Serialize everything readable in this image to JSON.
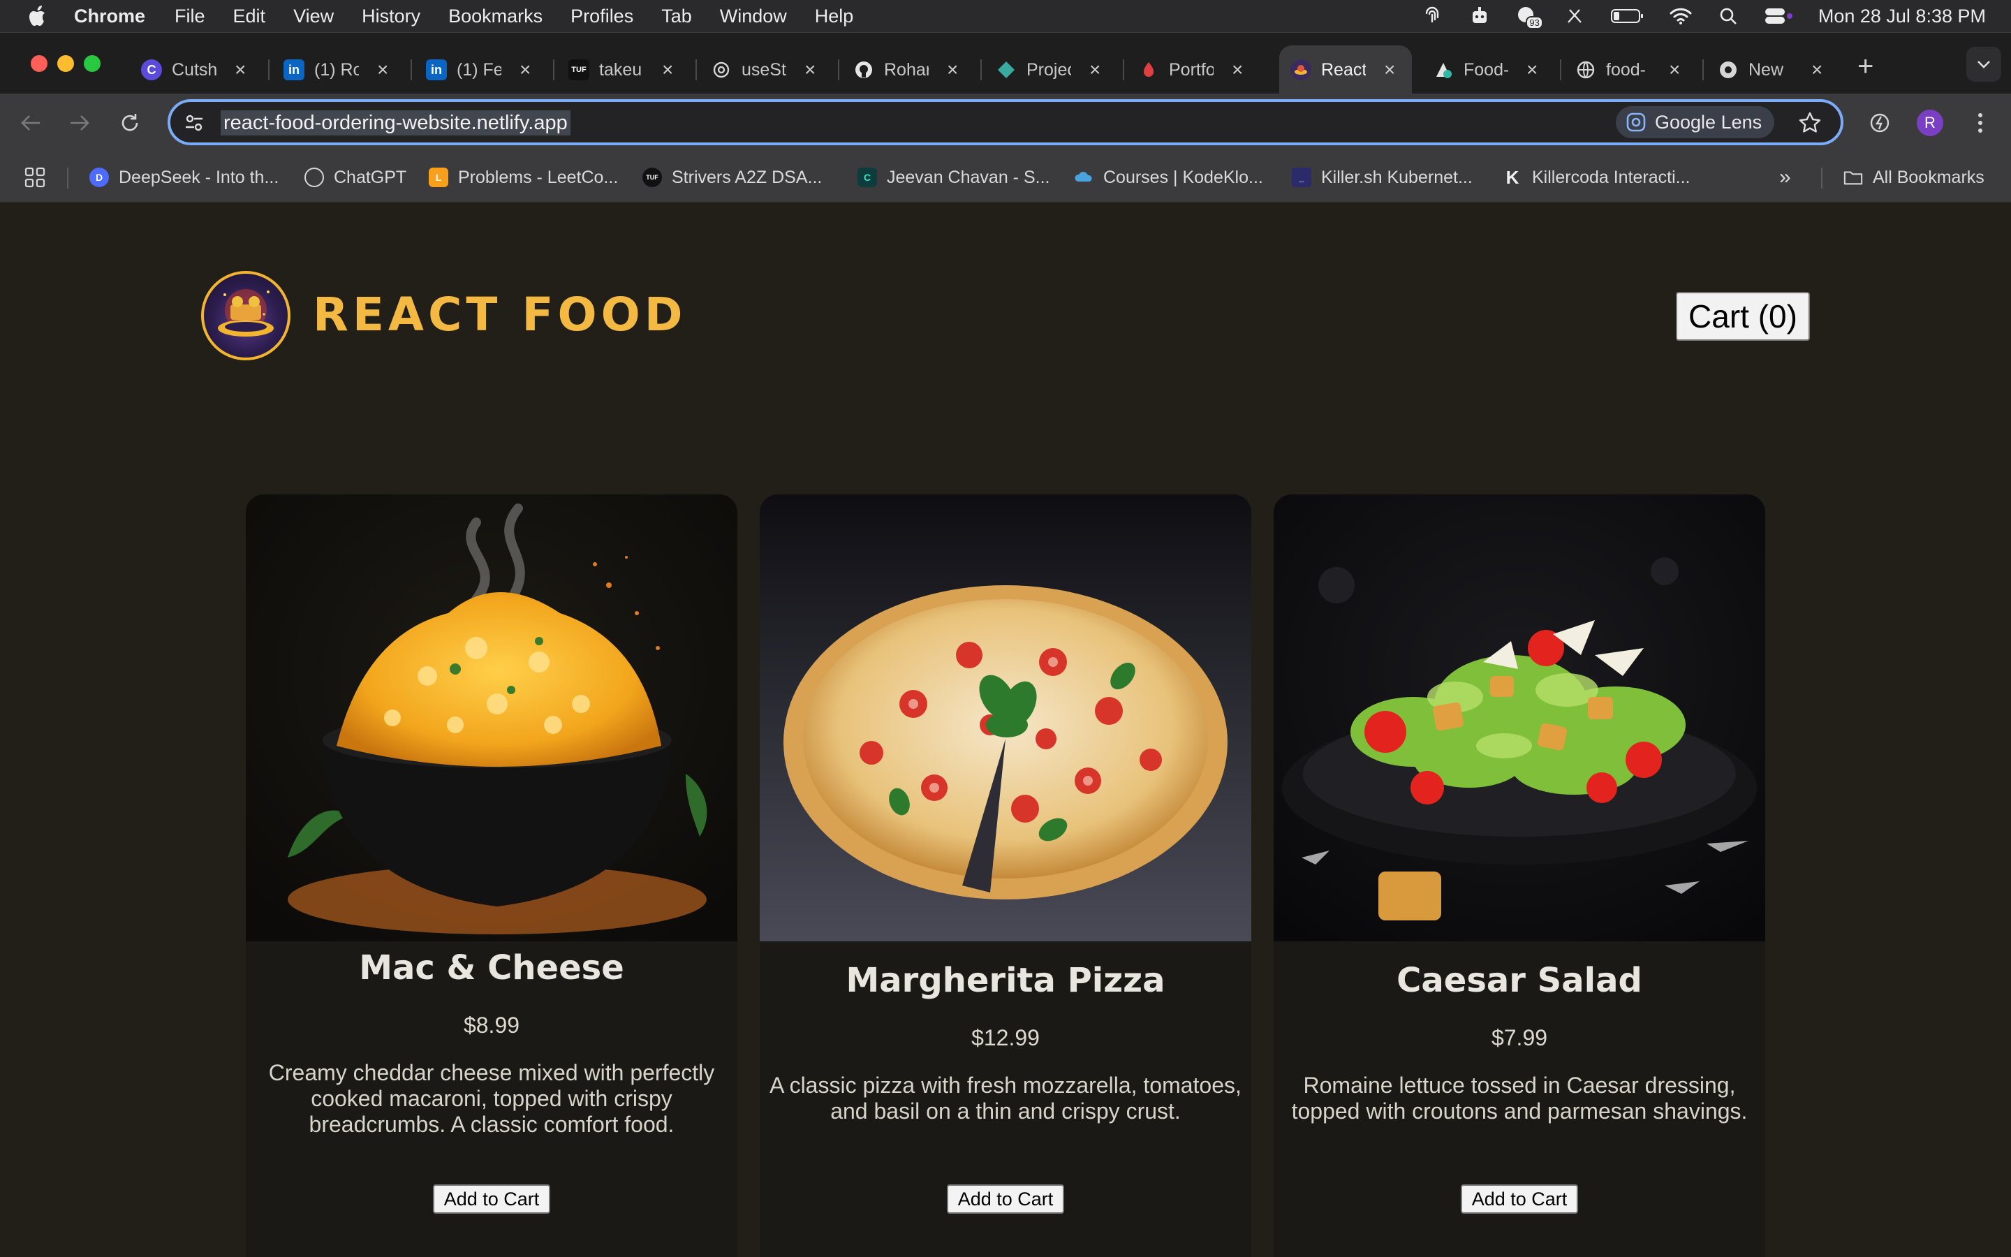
{
  "menubar": {
    "app_name": "Chrome",
    "items": [
      "File",
      "Edit",
      "View",
      "History",
      "Bookmarks",
      "Profiles",
      "Tab",
      "Window",
      "Help"
    ],
    "clock": "Mon 28 Jul  8:38 PM",
    "notification_badge": "93"
  },
  "tabs": [
    {
      "title": "Cutsh",
      "icon": "cutshort-icon"
    },
    {
      "title": "(1) Ro",
      "icon": "linkedin-icon"
    },
    {
      "title": "(1) Fe",
      "icon": "linkedin-icon"
    },
    {
      "title": "takeu",
      "icon": "tuf-icon"
    },
    {
      "title": "useSt",
      "icon": "openai-icon"
    },
    {
      "title": "Rohar",
      "icon": "github-icon"
    },
    {
      "title": "Projec",
      "icon": "project-icon"
    },
    {
      "title": "Portfo",
      "icon": "portfolio-icon"
    },
    {
      "title": "React",
      "icon": "react-food-icon",
      "active": true
    },
    {
      "title": "Food-",
      "icon": "netlify-icon"
    },
    {
      "title": "food-",
      "icon": "globe-icon"
    },
    {
      "title": "New",
      "icon": "chrome-icon"
    }
  ],
  "address_bar": {
    "url": "react-food-ordering-website.netlify.app",
    "lens_label": "Google Lens"
  },
  "profile_initial": "R",
  "bookmarks": [
    {
      "label": "DeepSeek - Into th...",
      "icon": "deepseek-icon"
    },
    {
      "label": "ChatGPT",
      "icon": "openai-icon"
    },
    {
      "label": "Problems - LeetCo...",
      "icon": "leetcode-icon"
    },
    {
      "label": "Strivers A2Z DSA...",
      "icon": "tuf-icon"
    },
    {
      "label": "Jeevan Chavan - S...",
      "icon": "codesignal-icon"
    },
    {
      "label": "Courses | KodeKlo...",
      "icon": "kodekloud-icon"
    },
    {
      "label": "Killer.sh Kubernet...",
      "icon": "killersh-icon"
    },
    {
      "label": "Killercoda Interacti...",
      "icon": "killercoda-icon"
    }
  ],
  "all_bookmarks_label": "All Bookmarks",
  "site": {
    "title": "REACT FOOD",
    "cart_label": "Cart (0)",
    "colors": {
      "background": "#221f18",
      "accent": "#f3b943",
      "card": "#1a1916"
    }
  },
  "meals": [
    {
      "name": "Mac & Cheese",
      "price": "$8.99",
      "description": "Creamy cheddar cheese mixed with perfectly cooked macaroni, topped with crispy breadcrumbs. A classic comfort food.",
      "button": "Add to Cart"
    },
    {
      "name": "Margherita Pizza",
      "price": "$12.99",
      "description": "A classic pizza with fresh mozzarella, tomatoes, and basil on a thin and crispy crust.",
      "button": "Add to Cart"
    },
    {
      "name": "Caesar Salad",
      "price": "$7.99",
      "description": "Romaine lettuce tossed in Caesar dressing, topped with croutons and parmesan shavings.",
      "button": "Add to Cart"
    }
  ]
}
